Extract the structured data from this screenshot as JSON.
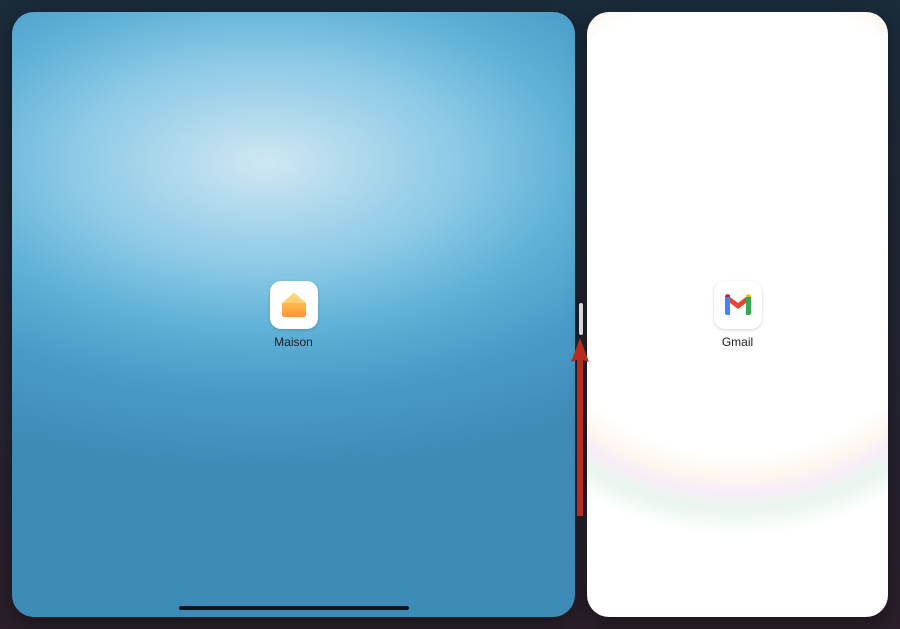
{
  "split_view": {
    "left_app": {
      "label": "Maison",
      "icon": "home-icon"
    },
    "right_app": {
      "label": "Gmail",
      "icon": "gmail-icon"
    }
  },
  "annotation": {
    "arrow_color": "#b52d1f",
    "arrow_direction": "up"
  }
}
